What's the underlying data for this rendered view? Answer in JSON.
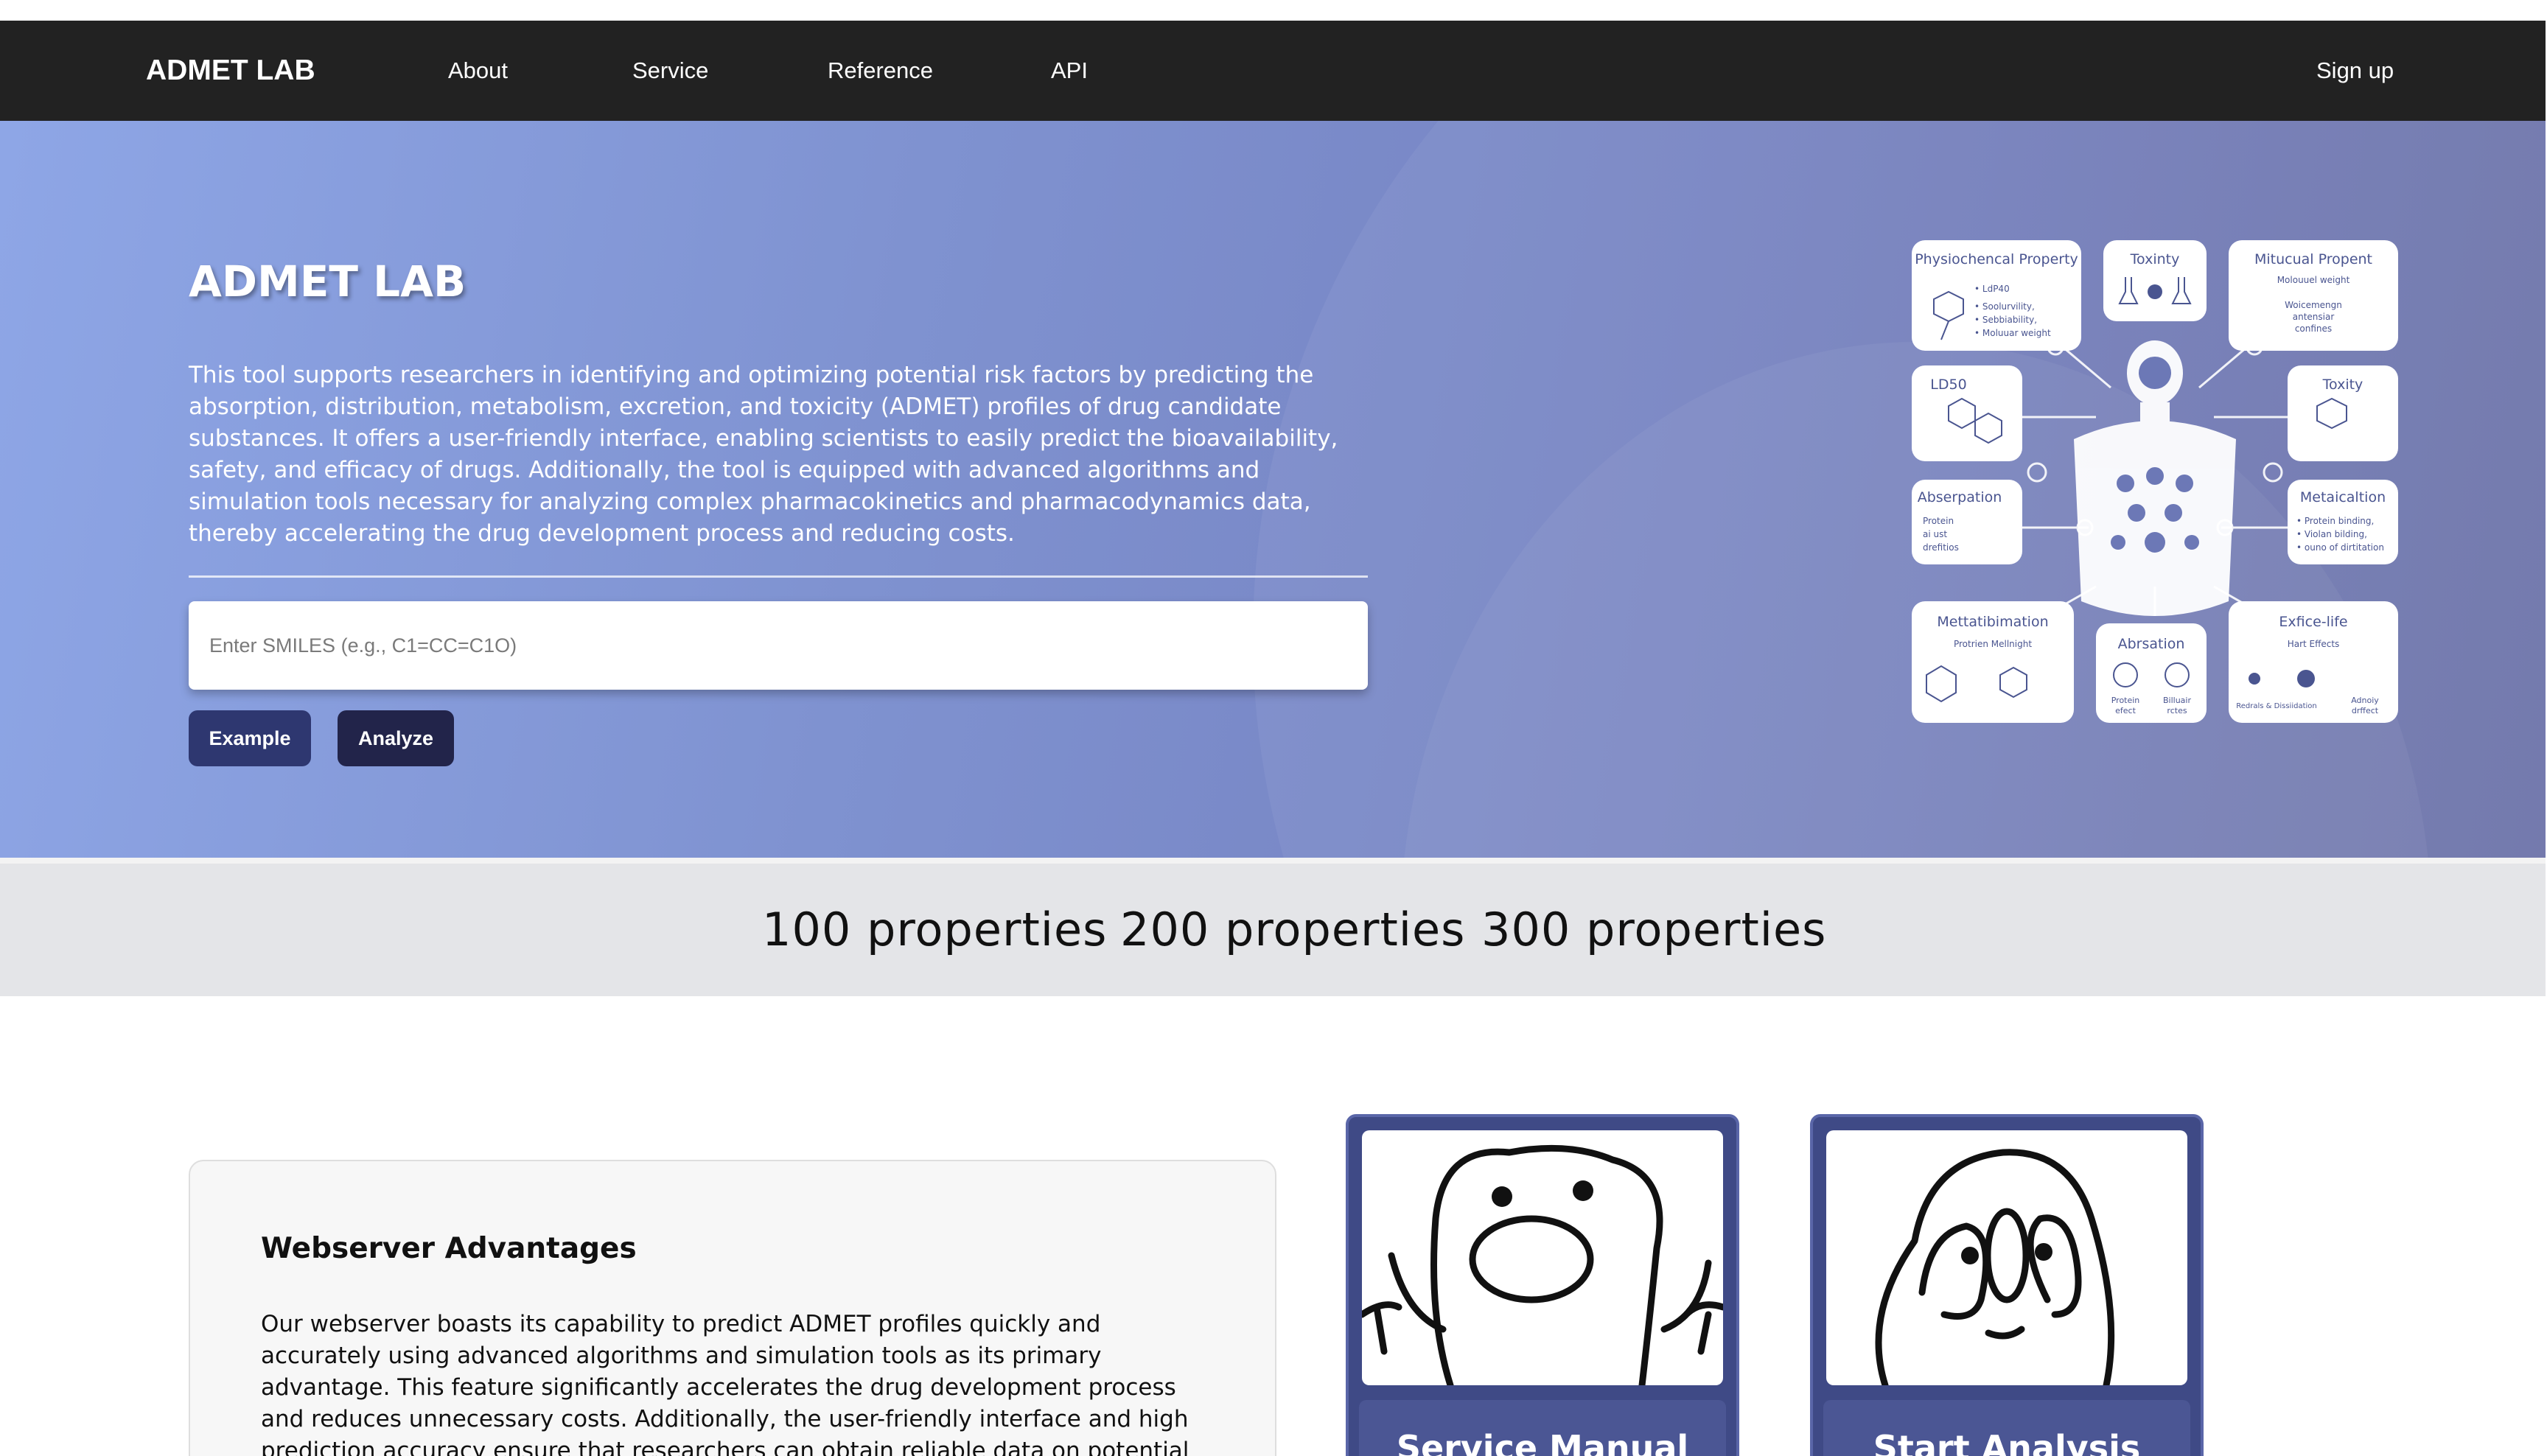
{
  "nav": {
    "brand": "ADMET LAB",
    "links": [
      "About",
      "Service",
      "Reference",
      "API"
    ],
    "signup": "Sign up"
  },
  "hero": {
    "title": "ADMET LAB",
    "description": "This tool supports researchers in identifying and optimizing potential risk factors by predicting the absorption, distribution, metabolism, excretion, and toxicity (ADMET) profiles of drug candidate substances. It offers a user-friendly interface, enabling scientists to easily predict the bioavailability, safety, and efficacy of drugs. Additionally, the tool is equipped with advanced algorithms and simulation tools necessary for analyzing complex pharmacokinetics and pharmacodynamics data, thereby accelerating the drug development process and reducing costs.",
    "input_placeholder": "Enter SMILES (e.g., C1=CC=C1O)",
    "input_value": "",
    "example_button": "Example",
    "analyze_button": "Analyze",
    "infographic": {
      "panels": {
        "physiochemical": "Physiochencal Property",
        "toxity_top": "Toxinty",
        "mitucual": "Mitucual Propent",
        "ld50": "LD50",
        "toxity_right": "Toxity",
        "abserpation": "Abserpation",
        "metaicaltion": "Metaicaltion",
        "mettatibimation": "Mettatibimation",
        "absration": "Abrsation",
        "exfice": "Exfice-life"
      },
      "small": {
        "phys_lines": [
          "• LdP40",
          "• Soolurvility,",
          "• Sebbiability,",
          "• Moluuar weight"
        ],
        "mit_lines": [
          "Molouuel weight",
          "Woicemengn",
          "antensiar",
          "confines"
        ],
        "abs_lines": [
          "Protein",
          "ai ust",
          "drefitios"
        ],
        "meta_lines": [
          "• Protein binding,",
          "• Violan bilding,",
          "• ouno of dirtitation"
        ],
        "mett_sub": "Protrien Mellnight",
        "absr_lines": [
          "Protein",
          "efect",
          "Billuair",
          "rctes"
        ],
        "exf_sub": "Hart Effects",
        "exf_lines": [
          "Redrals & Dissiidation",
          "Adnoiy",
          "drffect"
        ]
      }
    }
  },
  "stats": {
    "s1": "100  properties",
    "s2": "200  properties",
    "s3": "300  properties"
  },
  "advantages": {
    "title": "Webserver Advantages",
    "body": "Our webserver boasts its capability to predict ADMET profiles quickly and accurately using advanced algorithms and simulation tools as its primary advantage. This feature significantly accelerates the drug development process and reduces unnecessary costs. Additionally, the user-friendly interface and high prediction accuracy ensure that researchers can obtain reliable data on potential drug candidates."
  },
  "cards": [
    {
      "label": "Service Manual"
    },
    {
      "label": "Start Analysis"
    }
  ],
  "colors": {
    "navbar": "#222222",
    "hero_start": "#8ea6e6",
    "hero_end": "#6c72a8",
    "example_btn": "#2e3770",
    "analyze_btn": "#22244a",
    "card_bg": "#3f4a86"
  }
}
